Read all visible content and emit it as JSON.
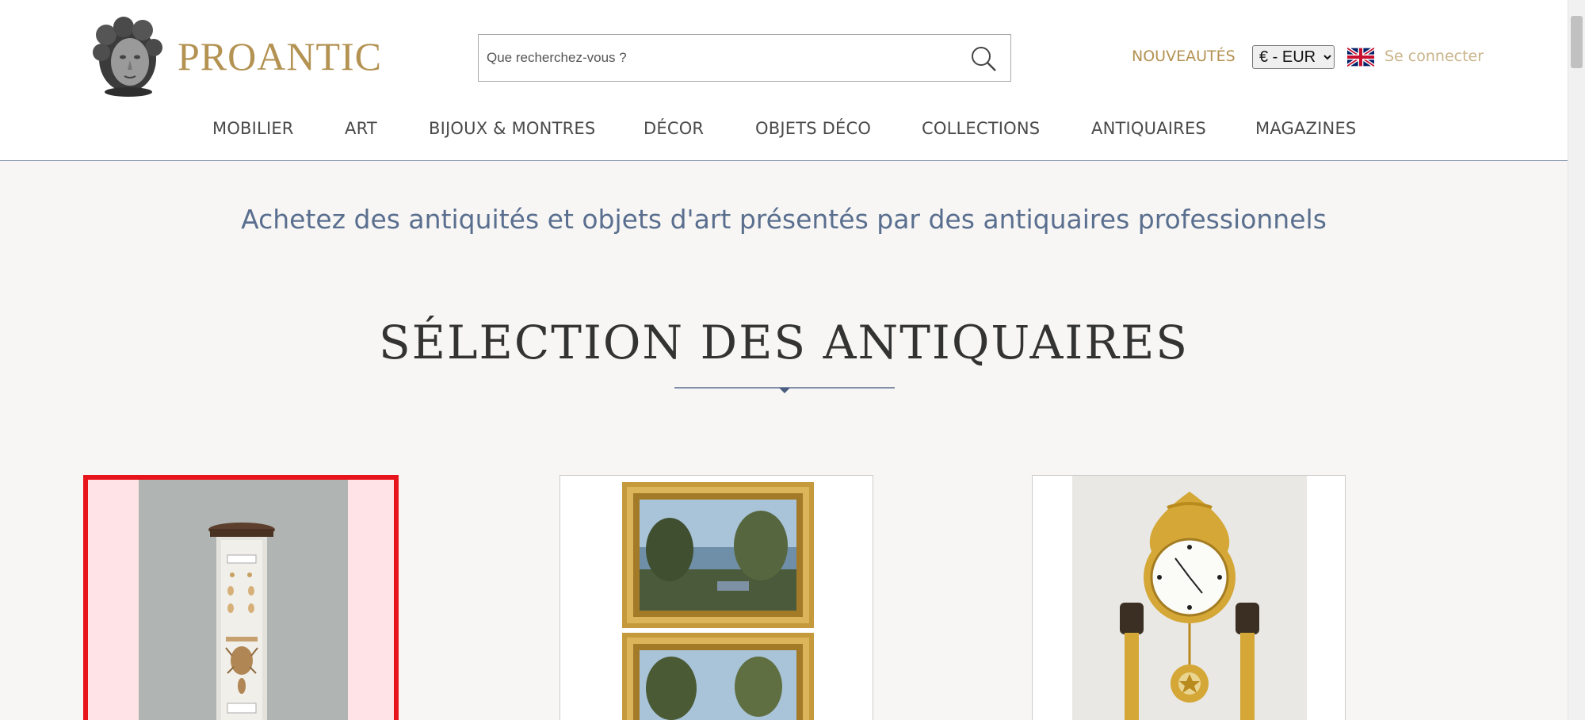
{
  "brand": {
    "name": "PROANTIC",
    "accent_color": "#b39252",
    "logo_icon": "cherub-head-logo-icon"
  },
  "search": {
    "placeholder": "Que recherchez-vous ?",
    "value": "",
    "icon": "search-icon"
  },
  "header": {
    "new_label": "NOUVEAUTÉS",
    "currency": {
      "selected": "€ - EUR",
      "options": [
        "€ - EUR"
      ]
    },
    "language_icon": "uk-flag-icon",
    "login_label": "Se connecter"
  },
  "nav": {
    "items": [
      {
        "label": "MOBILIER"
      },
      {
        "label": "ART"
      },
      {
        "label": "BIJOUX & MONTRES"
      },
      {
        "label": "DÉCOR"
      },
      {
        "label": "OBJETS DÉCO"
      },
      {
        "label": "COLLECTIONS"
      },
      {
        "label": "ANTIQUAIRES"
      },
      {
        "label": "MAGAZINES"
      }
    ]
  },
  "main": {
    "tagline": "Achetez des antiquités et objets d'art présentés par des antiquaires professionnels",
    "section_title": "SÉLECTION DES ANTIQUAIRES",
    "products": [
      {
        "image": "glass-specimen-display-case-image",
        "selected": true,
        "highlight_color": "#e8141b"
      },
      {
        "image": "framed-landscape-paintings-pair-image",
        "selected": false
      },
      {
        "image": "gilt-bronze-portico-clock-image",
        "selected": false
      }
    ]
  }
}
